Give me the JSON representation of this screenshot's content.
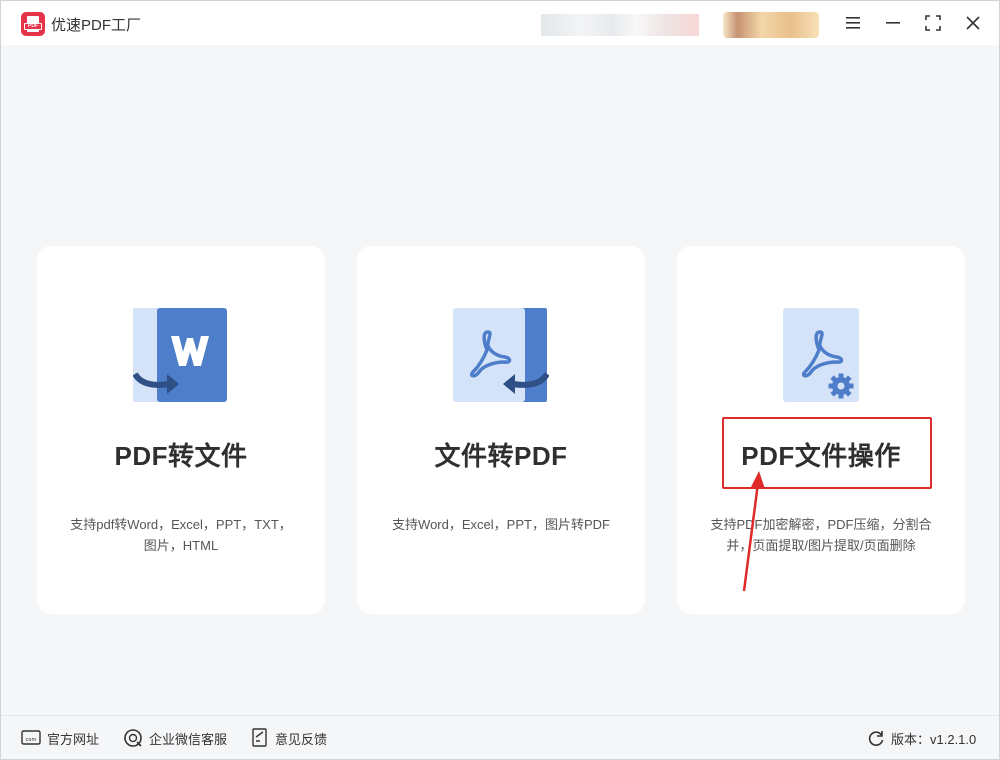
{
  "app": {
    "title": "优速PDF工厂",
    "logo_text": "PDF"
  },
  "titlebar": {
    "menu_icon": "menu-icon",
    "minimize_icon": "minimize-icon",
    "maximize_icon": "maximize-icon",
    "close_icon": "close-icon"
  },
  "cards": [
    {
      "title": "PDF转文件",
      "desc_lines": [
        "支持pdf转Word，Excel，PPT，TXT，",
        "图片，HTML"
      ],
      "icon": "word-document-icon"
    },
    {
      "title": "文件转PDF",
      "desc_lines": [
        "支持Word，Excel，PPT，图片转PDF"
      ],
      "icon": "pdf-document-icon"
    },
    {
      "title": "PDF文件操作",
      "desc_lines": [
        "支持PDF加密解密，PDF压缩，分割合",
        "并，页面提取/图片提取/页面删除"
      ],
      "icon": "pdf-settings-icon"
    }
  ],
  "footer": {
    "website": "官方网址",
    "wechat": "企业微信客服",
    "feedback": "意见反馈",
    "version": "版本：v1.2.1.0"
  },
  "colors": {
    "accent_blue": "#4e7ec9",
    "light_blue": "#d5e3f8",
    "highlight_red": "#e02a2a",
    "logo_red": "#e5344a"
  }
}
